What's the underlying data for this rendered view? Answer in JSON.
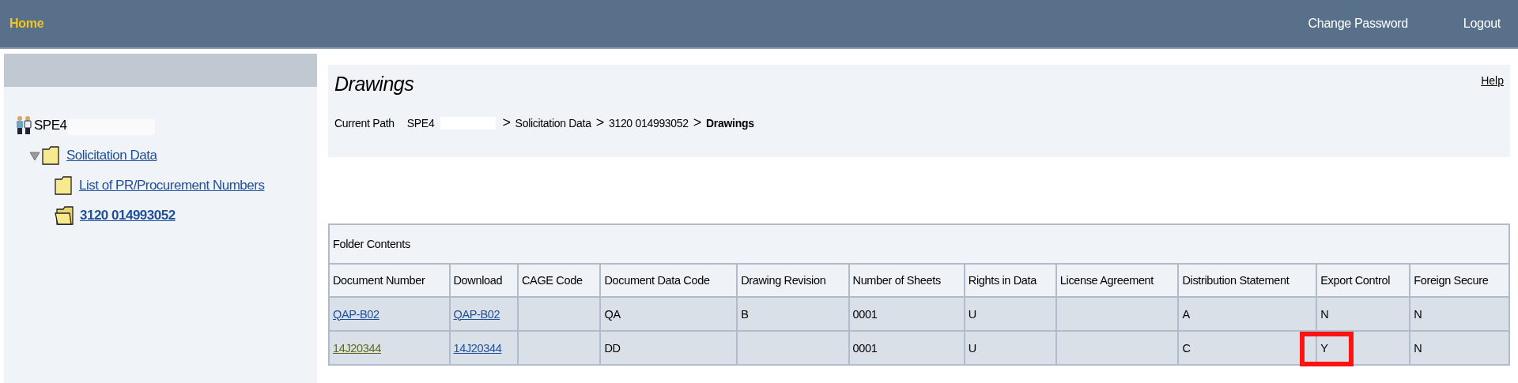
{
  "top_bar": {
    "home": "Home",
    "links": [
      "Change Password",
      "Logout"
    ]
  },
  "tree": [
    {
      "label": "SPE4",
      "kind": "group",
      "redacted": true,
      "selected": false,
      "children": [
        {
          "label": "Solicitation Data",
          "kind": "folder",
          "expanded": true,
          "selected": false,
          "children": [
            {
              "label": "List of PR/Procurement Numbers",
              "kind": "folder",
              "selected": false
            },
            {
              "label": "3120 014993052",
              "kind": "open-folder",
              "selected": true
            }
          ]
        }
      ]
    }
  ],
  "page": {
    "title": "Drawings",
    "help": "Help",
    "path_label": "Current Path",
    "path": [
      {
        "text": "SPE4",
        "redacted": true,
        "current": false
      },
      {
        "text": "Solicitation Data",
        "redacted": false,
        "current": false
      },
      {
        "text": "3120 014993052",
        "redacted": false,
        "current": false
      },
      {
        "text": "Drawings",
        "redacted": false,
        "current": true
      }
    ],
    "separator": ">"
  },
  "table": {
    "caption": "Folder Contents",
    "columns": [
      "Document Number",
      "Download",
      "CAGE Code",
      "Document Data Code",
      "Drawing Revision",
      "Number of Sheets",
      "Rights in Data",
      "License Agreement",
      "Distribution Statement",
      "Export Control",
      "Foreign Secure"
    ],
    "rows": [
      [
        {
          "kind": "link",
          "text": "QAP-B02",
          "highlighted": false
        },
        {
          "kind": "link",
          "text": "QAP-B02",
          "highlighted": false
        },
        {
          "kind": "empty",
          "highlighted": false
        },
        {
          "kind": "text",
          "text": "QA",
          "highlighted": false
        },
        {
          "kind": "text",
          "text": "B",
          "highlighted": false
        },
        {
          "kind": "text",
          "text": "0001",
          "highlighted": false
        },
        {
          "kind": "text",
          "text": "U",
          "highlighted": false
        },
        {
          "kind": "empty",
          "highlighted": false
        },
        {
          "kind": "text",
          "text": "A",
          "highlighted": false
        },
        {
          "kind": "text",
          "text": "N",
          "highlighted": false
        },
        {
          "kind": "text",
          "text": "N",
          "highlighted": false
        }
      ],
      [
        {
          "kind": "visited-link",
          "text": "14J20344",
          "highlighted": false
        },
        {
          "kind": "link",
          "text": "14J20344",
          "highlighted": false
        },
        {
          "kind": "empty",
          "highlighted": false
        },
        {
          "kind": "text",
          "text": "DD",
          "highlighted": false
        },
        {
          "kind": "empty",
          "highlighted": false
        },
        {
          "kind": "text",
          "text": "0001",
          "highlighted": false
        },
        {
          "kind": "text",
          "text": "U",
          "highlighted": false
        },
        {
          "kind": "empty",
          "highlighted": false
        },
        {
          "kind": "text",
          "text": "C",
          "highlighted": false
        },
        {
          "kind": "text",
          "text": "Y",
          "highlighted": true
        },
        {
          "kind": "text",
          "text": "N",
          "highlighted": false
        }
      ]
    ]
  }
}
